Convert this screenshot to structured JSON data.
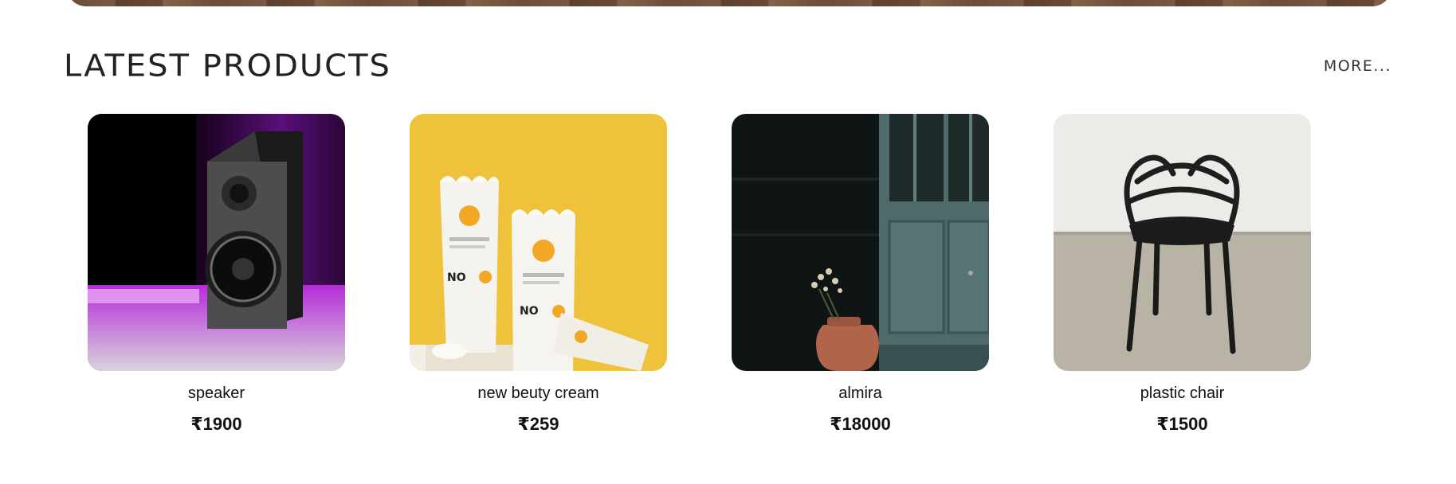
{
  "section": {
    "title": "LATEST PRODUCTS",
    "more_label": "MORE..."
  },
  "products": [
    {
      "name": "speaker",
      "price": "₹1900",
      "image": "speaker-photo"
    },
    {
      "name": "new beuty cream",
      "price": "₹259",
      "image": "cream-tubes-photo"
    },
    {
      "name": "almira",
      "price": "₹18000",
      "image": "almira-photo"
    },
    {
      "name": "plastic chair",
      "price": "₹1500",
      "image": "chair-photo"
    }
  ]
}
